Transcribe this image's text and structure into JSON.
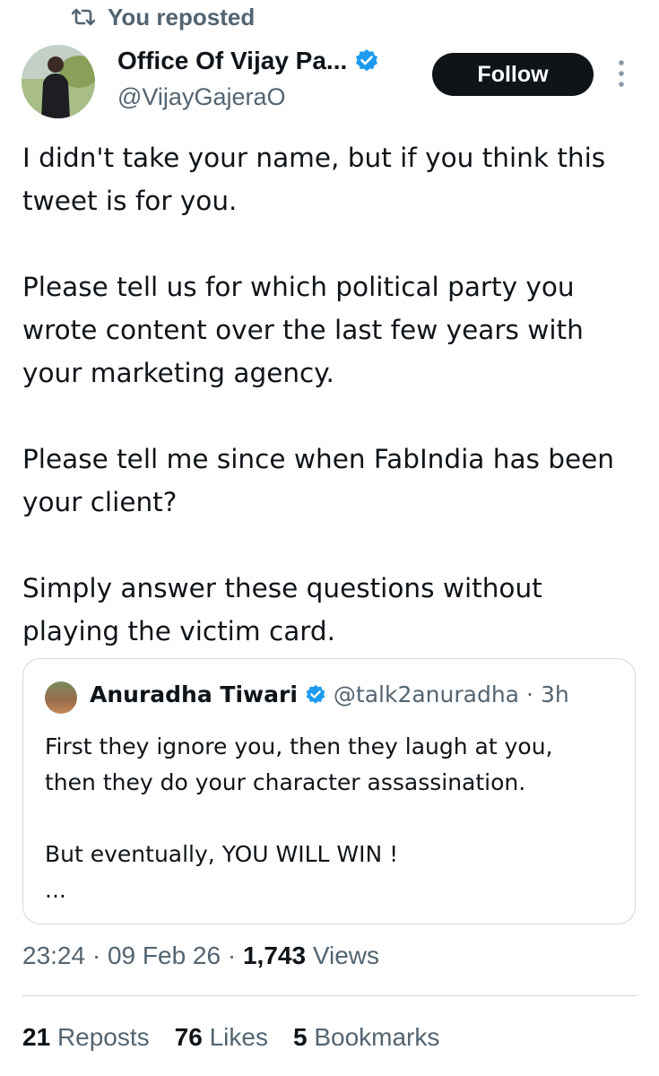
{
  "repost": {
    "icon": "repost-icon",
    "label": "You reposted"
  },
  "author": {
    "name": "Office Of Vijay Pa...",
    "handle": "@VijayGajeraO",
    "verified": true,
    "verified_color": "#1d9bf0"
  },
  "follow_button": {
    "label": "Follow"
  },
  "more_icon": "more-options-icon",
  "tweet": {
    "paragraphs": [
      "I didn't take your name, but if you think this tweet is for you.",
      "Please tell us for which political party you wrote content over the last few years with your marketing agency.",
      "Please tell me since when FabIndia has been your client?",
      "Simply answer these questions without playing the victim card."
    ]
  },
  "quoted_tweet": {
    "author_name": "Anuradha Tiwari",
    "handle": "@talk2anuradha",
    "separator": "·",
    "time": "3h",
    "verified": true,
    "lines": [
      "First they ignore you, then they laugh at you,",
      "then they do your character assassination.",
      "",
      "But eventually, YOU WILL WIN !",
      "..."
    ]
  },
  "meta": {
    "time": "23:24",
    "separator": "·",
    "date": "09 Feb 26",
    "views_count": "1,743",
    "views_label": "Views"
  },
  "stats": {
    "reposts_count": "21",
    "reposts_label": "Reposts",
    "likes_count": "76",
    "likes_label": "Likes",
    "bookmarks_count": "5",
    "bookmarks_label": "Bookmarks"
  },
  "colors": {
    "text_primary": "#0f1419",
    "text_secondary": "#536471",
    "border": "#cfd9de",
    "follow_bg": "#0f1419",
    "verified": "#1d9bf0"
  }
}
